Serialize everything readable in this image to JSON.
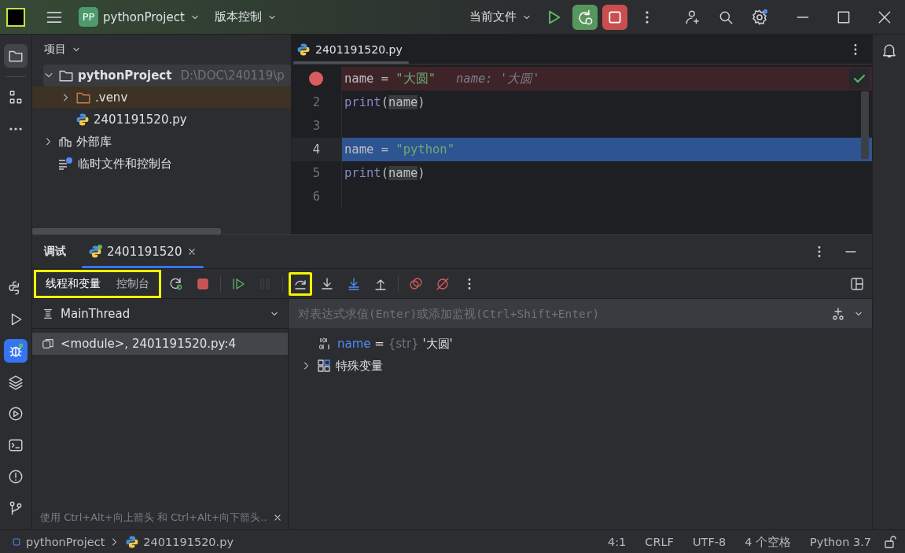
{
  "title_bar": {
    "project_badge": "PP",
    "project": "pythonProject",
    "vcs": "版本控制",
    "run_config": "当前文件"
  },
  "project_panel": {
    "title": "项目",
    "tree": [
      {
        "label": "pythonProject",
        "path": "D:\\DOC\\240119\\p",
        "kind": "folder",
        "expanded": true,
        "children": [
          {
            "label": ".venv",
            "kind": "excluded-folder",
            "expanded": false
          },
          {
            "label": "2401191520.py",
            "kind": "python"
          }
        ]
      },
      {
        "label": "外部库",
        "kind": "library",
        "expanded": false
      },
      {
        "label": "临时文件和控制台",
        "kind": "scratch"
      }
    ]
  },
  "editor": {
    "tab": "2401191520.py",
    "lines": [
      {
        "breakpoint": true,
        "current": false,
        "tokens": [
          {
            "text": "name",
            "kind": "var"
          },
          {
            "text": " = ",
            "kind": "op"
          },
          {
            "text": "\"大圆\"",
            "kind": "string"
          }
        ],
        "inline_value": "name: '大圆'"
      },
      {
        "number": "2",
        "breakpoint": false,
        "current": false,
        "tokens": [
          {
            "text": "print",
            "kind": "builtin"
          },
          {
            "text": "(",
            "kind": "op"
          },
          {
            "text": "name",
            "kind": "ref"
          },
          {
            "text": ")",
            "kind": "op"
          }
        ]
      },
      {
        "number": "3",
        "breakpoint": false,
        "current": false
      },
      {
        "number": "4",
        "breakpoint": false,
        "current": true,
        "tokens": [
          {
            "text": "name",
            "kind": "var"
          },
          {
            "text": " = ",
            "kind": "op"
          },
          {
            "text": "\"python\"",
            "kind": "string"
          }
        ]
      },
      {
        "number": "5",
        "breakpoint": false,
        "current": false,
        "tokens": [
          {
            "text": "print",
            "kind": "builtin"
          },
          {
            "text": "(",
            "kind": "op"
          },
          {
            "text": "name",
            "kind": "ref"
          },
          {
            "text": ")",
            "kind": "op"
          }
        ]
      },
      {
        "number": "6",
        "breakpoint": false,
        "current": false
      }
    ]
  },
  "debug_panel": {
    "title": "调试",
    "session_tab": "2401191520",
    "views": [
      {
        "label": "线程和变量",
        "selected": true
      },
      {
        "label": "控制台",
        "selected": false
      }
    ],
    "views_highlighted": true,
    "toolbar": [
      {
        "kind": "rerun",
        "disabled": false,
        "highlighted": false
      },
      {
        "kind": "stop",
        "disabled": false,
        "highlighted": false
      },
      {
        "kind": "resume",
        "disabled": false,
        "highlighted": false
      },
      {
        "kind": "pause",
        "disabled": true,
        "highlighted": false
      },
      {
        "kind": "step-over",
        "disabled": false,
        "highlighted": true
      },
      {
        "kind": "step-into",
        "disabled": false,
        "highlighted": false
      },
      {
        "kind": "step-into-my-code",
        "disabled": false,
        "highlighted": false
      },
      {
        "kind": "step-out",
        "disabled": false,
        "highlighted": false
      },
      {
        "kind": "breakpoints",
        "disabled": false,
        "highlighted": false
      },
      {
        "kind": "mute-breakpoints",
        "disabled": false,
        "highlighted": false
      },
      {
        "kind": "more",
        "disabled": false,
        "highlighted": false
      }
    ],
    "thread": "MainThread",
    "frames": [
      {
        "label": "<module>, 2401191520.py:4",
        "selected": true
      }
    ],
    "hint": "使用 Ctrl+Alt+向上箭头 和 Ctrl+Alt+向下箭头..",
    "eval_placeholder": "对表达式求值(Enter)或添加监视(Ctrl+Shift+Enter)",
    "variables": [
      {
        "kind": "value",
        "name": "name",
        "equals": "=",
        "type": "{str}",
        "value": "'大圆'"
      },
      {
        "kind": "group",
        "name": "特殊变量",
        "expanded": false
      }
    ]
  },
  "status_bar": {
    "breadcrumbs": [
      "pythonProject",
      "2401191520.py"
    ],
    "items": [
      "4:1",
      "CRLF",
      "UTF-8",
      "4 个空格",
      "Python 3.7"
    ]
  }
}
